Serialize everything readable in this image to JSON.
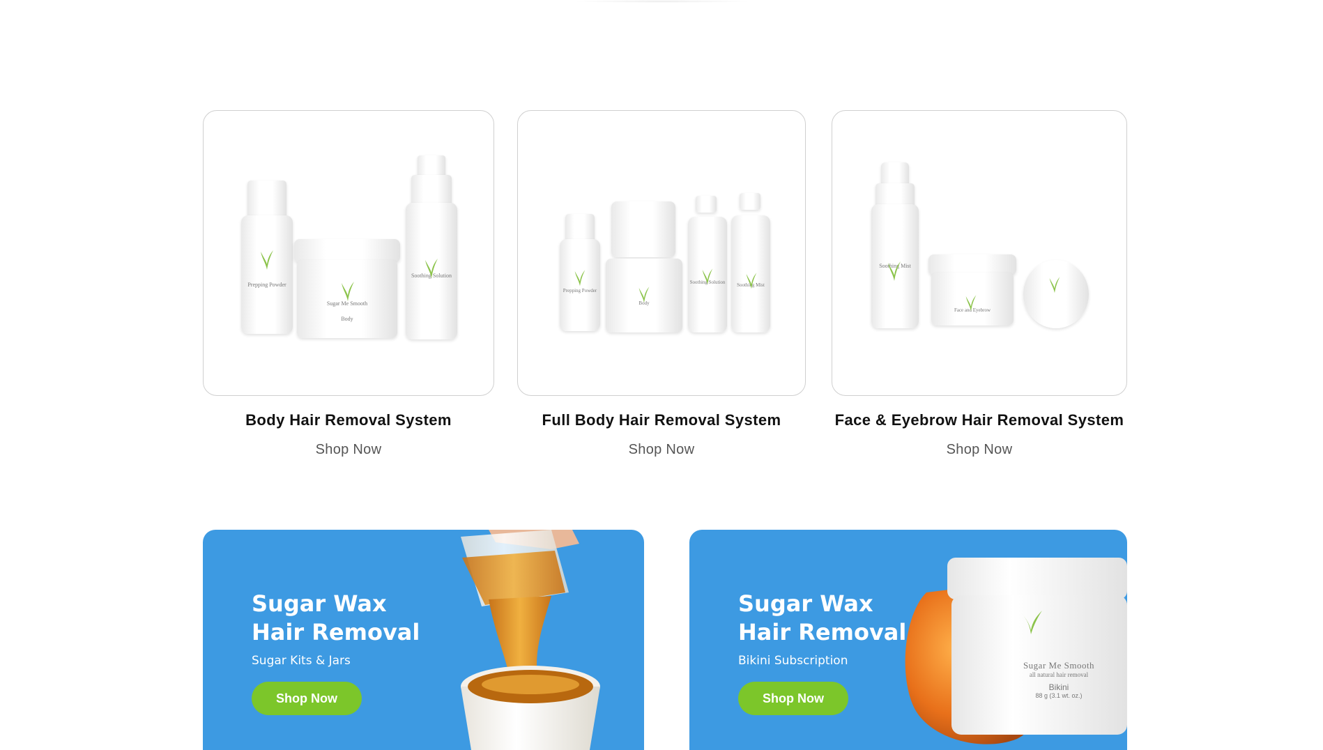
{
  "products": [
    {
      "title": "Body Hair Removal System",
      "link": "Shop Now"
    },
    {
      "title": "Full Body Hair Removal System",
      "link": "Shop Now"
    },
    {
      "title": "Face & Eyebrow Hair Removal System",
      "link": "Shop Now"
    }
  ],
  "banners": [
    {
      "title_line1": "Sugar Wax",
      "title_line2": "Hair Removal",
      "subtitle": "Sugar Kits & Jars",
      "button": "Shop Now"
    },
    {
      "title_line1": "Sugar Wax",
      "title_line2": "Hair Removal",
      "subtitle": "Bikini Subscription",
      "button": "Shop Now"
    }
  ],
  "product_labels": {
    "brand": "Sugar Me Smooth",
    "tagline": "all natural hair removal",
    "prepping_powder": "Prepping Powder",
    "body": "Body",
    "soothing_solution": "Soothing Solution",
    "soothing_mist": "Soothing Mist",
    "face_eyebrow": "Face and Eyebrow",
    "bikini": "Bikini",
    "bikini_weight": "88 g (3.1 wt. oz.)"
  },
  "colors": {
    "banner_bg": "#3d9ae2",
    "button_bg": "#7cc62a",
    "title_text": "#111111",
    "link_text": "#555555",
    "sugar_amber": "#e8a020"
  },
  "icons": {
    "leaf": "grass-leaf-logo-icon"
  }
}
